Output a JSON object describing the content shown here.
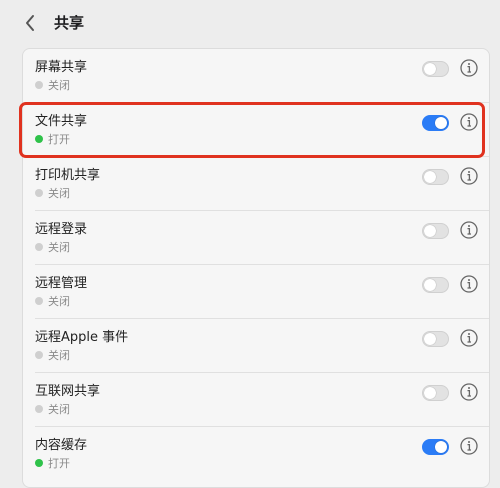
{
  "header": {
    "title": "共享"
  },
  "items": [
    {
      "name": "屏幕共享",
      "status": "关闭",
      "on": false
    },
    {
      "name": "文件共享",
      "status": "打开",
      "on": true
    },
    {
      "name": "打印机共享",
      "status": "关闭",
      "on": false
    },
    {
      "name": "远程登录",
      "status": "关闭",
      "on": false
    },
    {
      "name": "远程管理",
      "status": "关闭",
      "on": false
    },
    {
      "name": "远程Apple 事件",
      "status": "关闭",
      "on": false
    },
    {
      "name": "互联网共享",
      "status": "关闭",
      "on": false
    },
    {
      "name": "内容缓存",
      "status": "打开",
      "on": true
    }
  ],
  "colors": {
    "toggle_on": "#2b7cf6",
    "status_on": "#2fc24a",
    "status_off": "#cfcfcf",
    "highlight": "#e0321f"
  },
  "icons": {
    "back": "chevron-left-icon",
    "info": "info-circle-icon"
  }
}
